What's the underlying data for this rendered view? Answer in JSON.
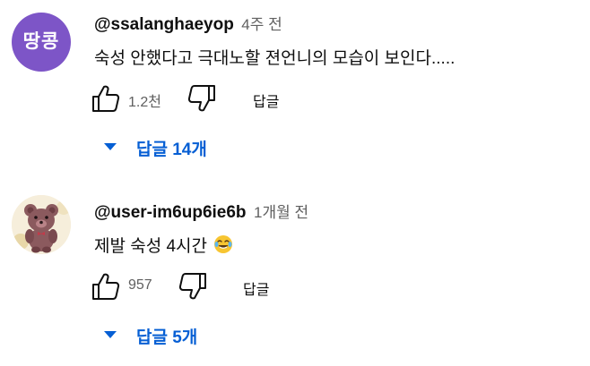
{
  "comments": [
    {
      "avatar_text": "땅콩",
      "author": "@ssalanghaeyop",
      "time": "4주 전",
      "text": "숙성 안했다고 극대노할 젼언니의 모습이 보인다.....",
      "likes": "1.2천",
      "reply_label": "답글",
      "replies_label": "답글 14개"
    },
    {
      "avatar_text": "",
      "author": "@user-im6up6ie6b",
      "time": "1개월 전",
      "text": "제발 숙성 4시간",
      "text_emoji": "😂",
      "likes": "957",
      "reply_label": "답글",
      "replies_label": "답글 5개"
    }
  ],
  "icons": {
    "like": "thumb-up-icon",
    "dislike": "thumb-down-icon",
    "expand": "caret-down-icon",
    "emoji": "face-with-tears-of-joy-icon"
  },
  "colors": {
    "link_blue": "#065fd4",
    "avatar1_bg": "#7d55c7",
    "meta_gray": "#606060",
    "text": "#0f0f0f"
  }
}
